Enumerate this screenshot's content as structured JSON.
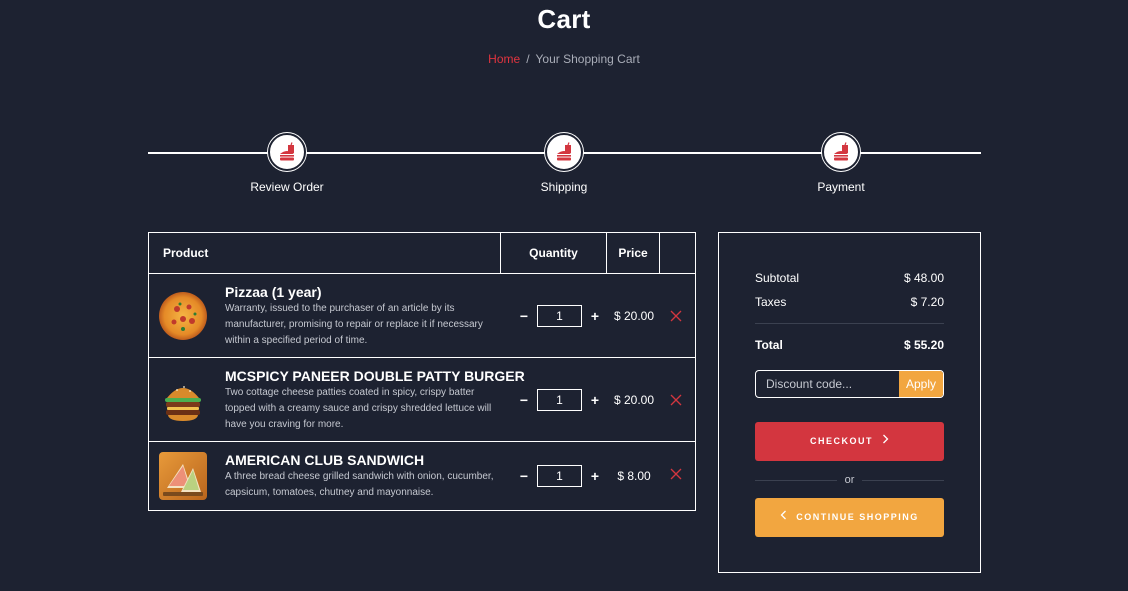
{
  "page": {
    "title": "Cart",
    "breadcrumb": {
      "home": "Home",
      "separator": "/",
      "current": "Your Shopping Cart"
    }
  },
  "steps": [
    {
      "label": "Review Order",
      "icon": "fast-food-icon"
    },
    {
      "label": "Shipping",
      "icon": "fast-food-icon"
    },
    {
      "label": "Payment",
      "icon": "fast-food-icon"
    }
  ],
  "table": {
    "headers": {
      "product": "Product",
      "quantity": "Quantity",
      "price": "Price"
    },
    "items": [
      {
        "name": "Pizzaa (1 year)",
        "description": "Warranty, issued to the purchaser of an article by its manufacturer, promising to repair or replace it if necessary within a specified period of time.",
        "quantity": "1",
        "price": "$ 20.00",
        "image": "pizza-image"
      },
      {
        "name": "MCSPICY PANEER DOUBLE PATTY BURGER",
        "description": "Two cottage cheese patties coated in spicy, crispy batter topped with a creamy sauce and crispy shredded lettuce will have you craving for more.",
        "quantity": "1",
        "price": "$ 20.00",
        "image": "burger-image"
      },
      {
        "name": "AMERICAN CLUB SANDWICH",
        "description": "A three bread cheese grilled sandwich with onion, cucumber, capsicum, tomatoes, chutney and mayonnaise.",
        "quantity": "1",
        "price": "$ 8.00",
        "image": "sandwich-image"
      }
    ],
    "decrement_label": "−",
    "increment_label": "+"
  },
  "summary": {
    "subtotal_label": "Subtotal",
    "subtotal_value": "$ 48.00",
    "taxes_label": "Taxes",
    "taxes_value": "$ 7.20",
    "total_label": "Total",
    "total_value": "$ 55.20",
    "discount_placeholder": "Discount code...",
    "apply_label": "Apply",
    "checkout_label": "CHECKOUT",
    "or_label": "or",
    "continue_label": "CONTINUE SHOPPING"
  },
  "colors": {
    "background": "#1d2231",
    "accent_red": "#d3363f",
    "accent_orange": "#f2a640",
    "text": "#ffffff"
  }
}
